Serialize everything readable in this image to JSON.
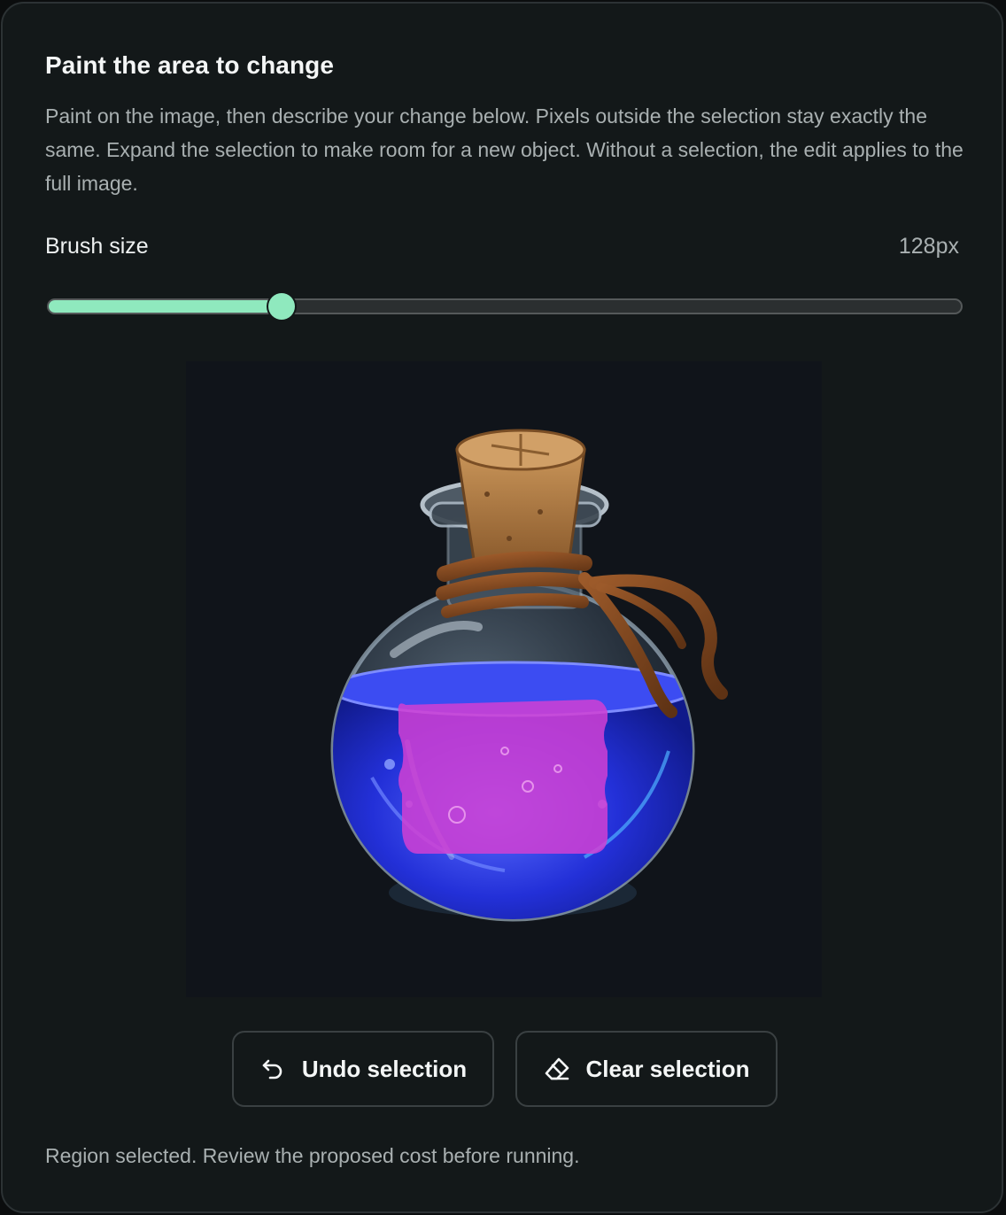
{
  "panel": {
    "title": "Paint the area to change",
    "description": "Paint on the image, then describe your change below. Pixels outside the selection stay exactly the same. Expand the selection to make room for a new object. Without a selection, the edit applies to the full image."
  },
  "brush": {
    "label": "Brush size",
    "value_text": "128px",
    "level_fraction": 0.255
  },
  "image": {
    "subject": "potion-bottle",
    "selection_color": "#d13fd4"
  },
  "actions": {
    "undo_label": "Undo selection",
    "undo_icon": "undo-icon",
    "clear_label": "Clear selection",
    "clear_icon": "eraser-icon"
  },
  "status": {
    "text": "Region selected. Review the proposed cost before running."
  },
  "colors": {
    "accent": "#8fe9be",
    "panel_bg": "#131819",
    "border": "#2c3234"
  }
}
